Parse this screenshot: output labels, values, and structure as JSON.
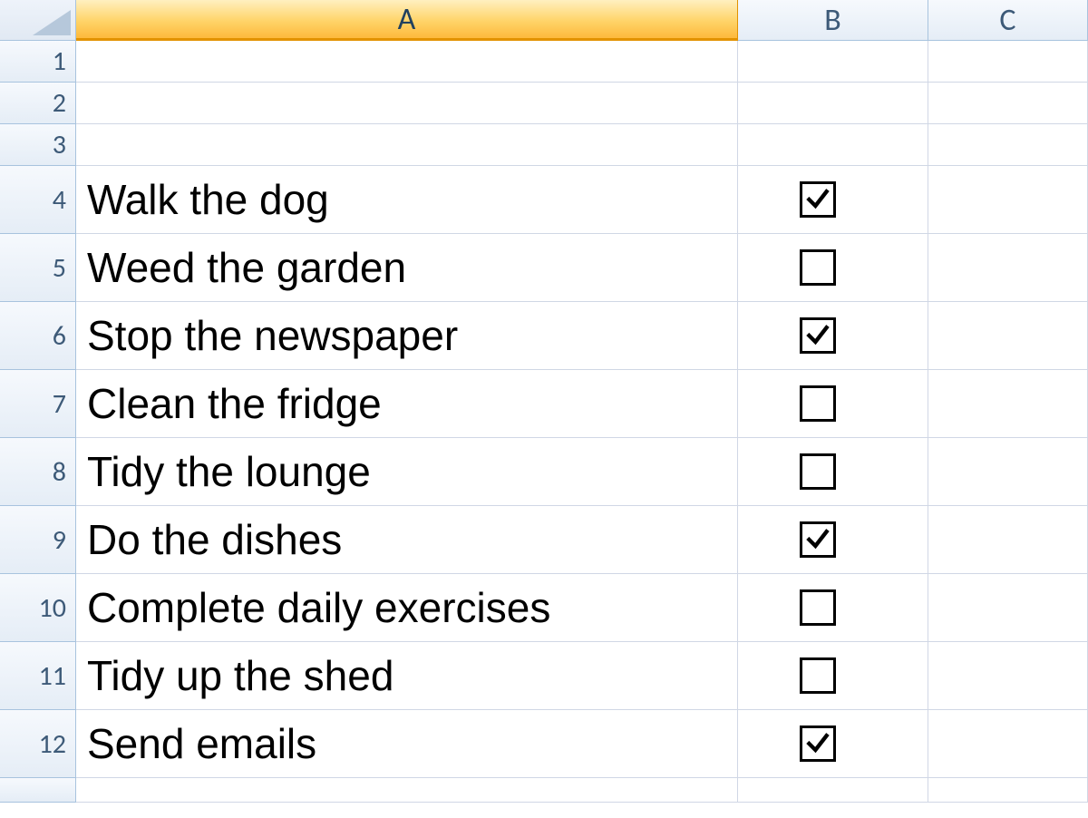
{
  "columns": {
    "A": "A",
    "B": "B",
    "C": "C"
  },
  "rows": {
    "1": {
      "num": "1",
      "A": "",
      "B_checkbox": null
    },
    "2": {
      "num": "2",
      "A": "",
      "B_checkbox": null
    },
    "3": {
      "num": "3",
      "A": "",
      "B_checkbox": null
    },
    "4": {
      "num": "4",
      "A": "Walk the dog",
      "B_checkbox": true
    },
    "5": {
      "num": "5",
      "A": "Weed the garden",
      "B_checkbox": false
    },
    "6": {
      "num": "6",
      "A": "Stop the newspaper",
      "B_checkbox": true
    },
    "7": {
      "num": "7",
      "A": "Clean the fridge",
      "B_checkbox": false
    },
    "8": {
      "num": "8",
      "A": "Tidy the lounge",
      "B_checkbox": false
    },
    "9": {
      "num": "9",
      "A": "Do the dishes",
      "B_checkbox": true
    },
    "10": {
      "num": "10",
      "A": "Complete daily exercises",
      "B_checkbox": false
    },
    "11": {
      "num": "11",
      "A": "Tidy up the shed",
      "B_checkbox": false
    },
    "12": {
      "num": "12",
      "A": "Send emails",
      "B_checkbox": true
    }
  },
  "selected_column": "A"
}
